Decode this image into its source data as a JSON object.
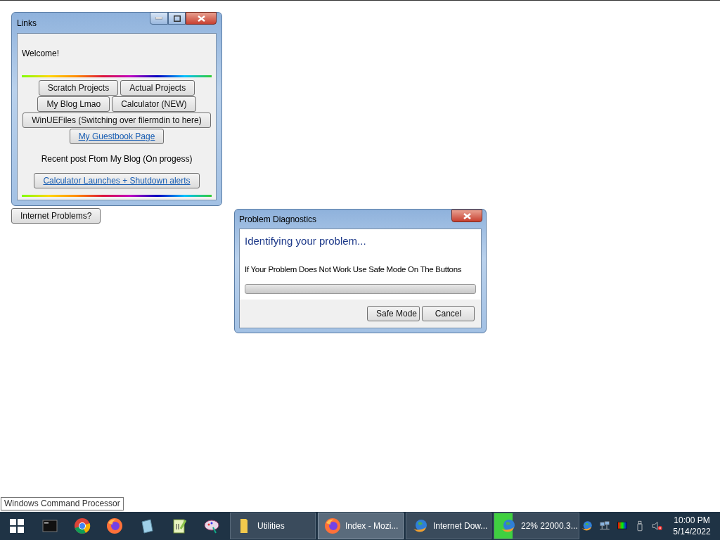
{
  "links_window": {
    "title": "Links",
    "greeting": "Welcome!",
    "button_rows": [
      [
        {
          "label": "Scratch Projects",
          "kind": "button"
        },
        {
          "label": "Actual Projects",
          "kind": "button"
        }
      ],
      [
        {
          "label": "My Blog Lmao",
          "kind": "button"
        },
        {
          "label": "Calculator (NEW)",
          "kind": "button"
        }
      ],
      [
        {
          "label": "WinUEFiles (Switching over filermdin to here)",
          "kind": "button"
        }
      ],
      [
        {
          "label": "My Guestbook Page",
          "kind": "link"
        }
      ]
    ],
    "recent_heading": "Recent post Ftom My Blog (On progess)",
    "recent_link": "Calculator Launches + Shutdown alerts"
  },
  "internet_button": "Internet Problems?",
  "dialog": {
    "title": "Problem Diagnostics",
    "heading": "Identifying your problem...",
    "message": "If Your Problem Does Not Work Use Safe Mode On The Buttons",
    "progress": {
      "level": 0
    },
    "buttons": [
      "Safe Mode",
      "Cancel"
    ]
  },
  "tooltip": "Windows Command Processor",
  "taskbar": {
    "pinned": [
      {
        "kind": "cmd"
      },
      {
        "kind": "chrome"
      },
      {
        "kind": "firefox"
      },
      {
        "kind": "notes"
      },
      {
        "kind": "notepadpp"
      },
      {
        "kind": "paint"
      }
    ],
    "tasks": [
      {
        "label": "Utilities",
        "kind": "folder",
        "selected": false
      },
      {
        "label": "Index - Mozi...",
        "kind": "firefox",
        "selected": true
      },
      {
        "label": "Internet Dow...",
        "kind": "idm",
        "selected": false
      },
      {
        "label": "22% 22000.3...",
        "kind": "idm",
        "selected": false,
        "level": 0.22
      }
    ],
    "tray": [
      {
        "kind": "idm"
      },
      {
        "kind": "network"
      },
      {
        "kind": "display"
      },
      {
        "kind": "usb"
      },
      {
        "kind": "volume_muted"
      }
    ],
    "time": "10:00 PM",
    "date": "5/14/2022"
  }
}
